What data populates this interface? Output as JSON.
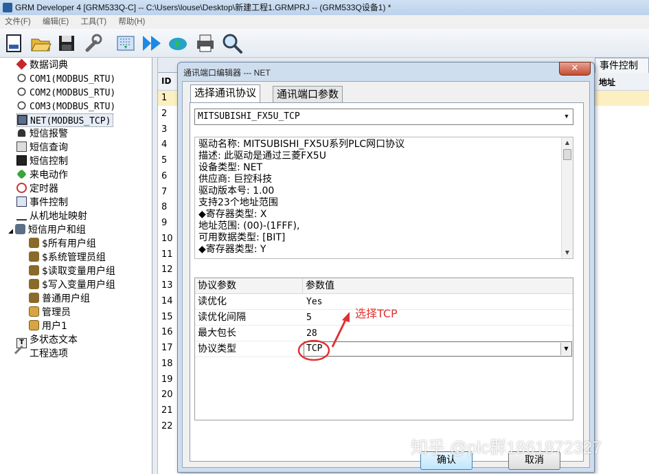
{
  "window": {
    "title": "GRM Developer 4 [GRM533Q-C]  -- C:\\Users\\louse\\Desktop\\新建工程1.GRMPRJ -- (GRM533Q设备1) *"
  },
  "menu": [
    "文件(F)",
    "编辑(E)",
    "工具(T)",
    "帮助(H)"
  ],
  "toolbar": [
    "new-icon",
    "open-folder-icon",
    "save-icon",
    "wrench-icon",
    "download-icon",
    "run-arrow-icon",
    "cloud-sync-icon",
    "print-icon",
    "search-icon"
  ],
  "tree": [
    {
      "label": "数据词典",
      "icon": "red-cube-icon"
    },
    {
      "label": "COM1(MODBUS_RTU)",
      "icon": "link-icon"
    },
    {
      "label": "COM2(MODBUS_RTU)",
      "icon": "link-icon"
    },
    {
      "label": "COM3(MODBUS_RTU)",
      "icon": "link-icon"
    },
    {
      "label": "NET(MODBUS_TCP)",
      "icon": "network-icon"
    },
    {
      "label": "短信报警",
      "icon": "bell-icon"
    },
    {
      "label": "短信查询",
      "icon": "query-icon"
    },
    {
      "label": "短信控制",
      "icon": "cmd-icon"
    },
    {
      "label": "来电动作",
      "icon": "phone-icon"
    },
    {
      "label": "定时器",
      "icon": "clock-icon"
    },
    {
      "label": "事件控制",
      "icon": "event-icon"
    },
    {
      "label": "从机地址映射",
      "icon": "binary-icon"
    },
    {
      "label": "短信用户和组",
      "icon": "users-icon"
    },
    {
      "label": "$所有用户组",
      "icon": "group-icon"
    },
    {
      "label": "$系统管理员组",
      "icon": "group-icon"
    },
    {
      "label": "$读取变量用户组",
      "icon": "group-icon"
    },
    {
      "label": "$写入变量用户组",
      "icon": "group-icon"
    },
    {
      "label": "普通用户组",
      "icon": "group-icon"
    },
    {
      "label": "管理员",
      "icon": "user-icon"
    },
    {
      "label": "用户1",
      "icon": "user-icon"
    },
    {
      "label": "多状态文本",
      "icon": "text-icon"
    },
    {
      "label": "工程选项",
      "icon": "tool-icon"
    }
  ],
  "grid": {
    "tab_event": "事件控制",
    "col_id": "ID",
    "col_addr": "地址",
    "rows": [
      "1",
      "2",
      "3",
      "4",
      "5",
      "6",
      "7",
      "8",
      "9",
      "10",
      "11",
      "12",
      "13",
      "14",
      "15",
      "16",
      "17",
      "18",
      "19",
      "20",
      "21",
      "22"
    ]
  },
  "dialog": {
    "title": "通讯端口编辑器 --- NET",
    "tabs": [
      "选择通讯协议",
      "通讯端口参数"
    ],
    "protocol": "MITSUBISHI_FX5U_TCP",
    "description": [
      "驱动名称: MITSUBISHI_FX5U系列PLC网口协议",
      "描述: 此驱动是通过三菱FX5U",
      "设备类型: NET",
      "供应商: 巨控科技",
      "驱动版本号: 1.00",
      "支持23个地址范围",
      "◆寄存器类型: X",
      "地址范围: (00)-(1FFF),",
      "可用数据类型: [BIT]",
      "◆寄存器类型: Y"
    ],
    "param_headers": [
      "协议参数",
      "参数值"
    ],
    "params": [
      {
        "name": "读优化",
        "value": "Yes"
      },
      {
        "name": "读优化间隔",
        "value": "5"
      },
      {
        "name": "最大包长",
        "value": "28"
      },
      {
        "name": "协议类型",
        "value": "TCP"
      }
    ],
    "ok": "确认",
    "cancel": "取消"
  },
  "annotation": "选择TCP",
  "watermark": "知乎 @plc群1861872327",
  "colors": {
    "annotation": "#e03232",
    "selected_row": "#fcefc2",
    "accent": "#3c7fb1"
  }
}
